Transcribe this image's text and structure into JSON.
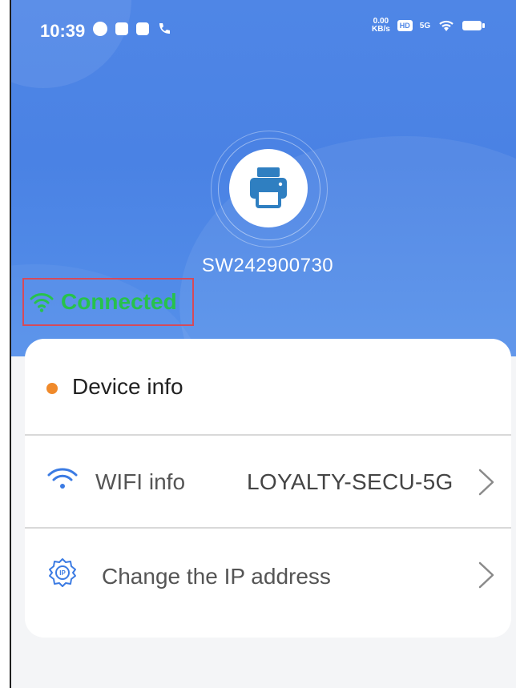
{
  "status_bar": {
    "time": "10:39",
    "speed_value": "0.00",
    "speed_unit": "KB/s",
    "hd_label": "HD",
    "network_label": "5G"
  },
  "device": {
    "name": "SW242900730",
    "connection_status": "Connected"
  },
  "card": {
    "device_info_label": "Device info",
    "wifi_info_label": "WIFI info",
    "wifi_ssid": "LOYALTY-SECU-5G",
    "change_ip_label": "Change the IP address"
  },
  "colors": {
    "hero_blue": "#4f86e6",
    "connected_green": "#27c24c",
    "highlight_red": "#d54a5a",
    "dot_orange": "#f08a2b",
    "wifi_icon_blue": "#3b7be3"
  },
  "icons": {
    "printer": "printer-icon",
    "wifi": "wifi-icon",
    "gear": "ip-settings-icon",
    "chevron": "chevron-right-icon"
  }
}
